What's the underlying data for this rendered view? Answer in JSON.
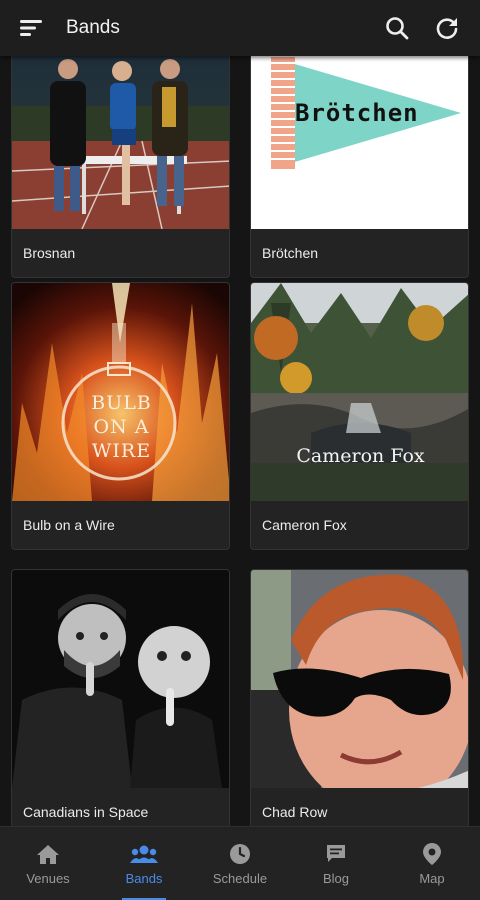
{
  "header": {
    "title": "Bands",
    "menu_icon": "hamburger-menu-icon",
    "search_icon": "search-icon",
    "refresh_icon": "refresh-icon"
  },
  "bands": [
    {
      "name": "Brosnan"
    },
    {
      "name": "Brötchen",
      "image_text": "Brötchen"
    },
    {
      "name": "Bulb on a Wire",
      "image_text": [
        "BULB",
        "ON A",
        "WIRE"
      ]
    },
    {
      "name": "Cameron Fox",
      "image_text": "Cameron Fox"
    },
    {
      "name": "Canadians in Space"
    },
    {
      "name": "Chad Row"
    }
  ],
  "nav": [
    {
      "label": "Venues",
      "icon": "home-icon"
    },
    {
      "label": "Bands",
      "icon": "group-icon",
      "active": true
    },
    {
      "label": "Schedule",
      "icon": "clock-icon"
    },
    {
      "label": "Blog",
      "icon": "chat-icon"
    },
    {
      "label": "Map",
      "icon": "map-pin-icon"
    }
  ],
  "colors": {
    "accent": "#4b8be8",
    "background": "#151515",
    "card": "#232323"
  }
}
